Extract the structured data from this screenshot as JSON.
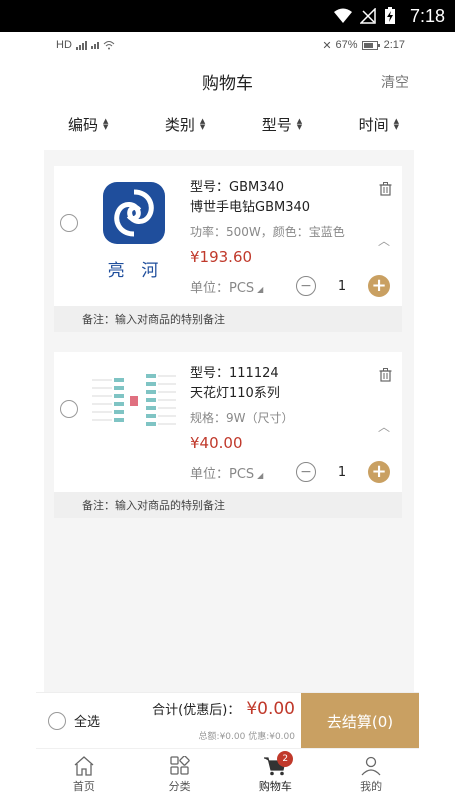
{
  "system_bar": {
    "time": "7:18"
  },
  "inner_status": {
    "left_text": "HD",
    "battery_text": "67%",
    "time": "2:17"
  },
  "header": {
    "title": "购物车",
    "clear_label": "清空"
  },
  "sort_tabs": [
    {
      "label": "编码"
    },
    {
      "label": "类别"
    },
    {
      "label": "型号"
    },
    {
      "label": "时间"
    }
  ],
  "cart_items": [
    {
      "model_line": "型号：GBM340",
      "name": "博世手电钻GBM340",
      "spec": "功率：500W，颜色：宝蓝色",
      "price": "¥193.60",
      "unit_label": "单位：PCS",
      "quantity": "1",
      "remark": "备注：输入对商品的特别备注",
      "logo_text": "亮  河"
    },
    {
      "model_line": "型号：111124",
      "name": "天花灯110系列",
      "spec": "规格：9W（尺寸）",
      "price": "¥40.00",
      "unit_label": "单位：PCS",
      "quantity": "1",
      "remark": "备注：输入对商品的特别备注"
    }
  ],
  "checkout": {
    "select_all_label": "全选",
    "total_label": "合计(优惠后)：",
    "total_amount": "¥0.00",
    "discount_text": "总额:¥0.00 优惠:¥0.00",
    "button_label": "去结算(0)"
  },
  "tabs": [
    {
      "label": "首页",
      "icon": "home-icon"
    },
    {
      "label": "分类",
      "icon": "category-icon"
    },
    {
      "label": "购物车",
      "icon": "cart-icon",
      "badge": "2"
    },
    {
      "label": "我的",
      "icon": "profile-icon"
    }
  ],
  "colors": {
    "accent": "#c9a062",
    "price": "#c0392b",
    "brand_blue": "#1f4e9c"
  }
}
